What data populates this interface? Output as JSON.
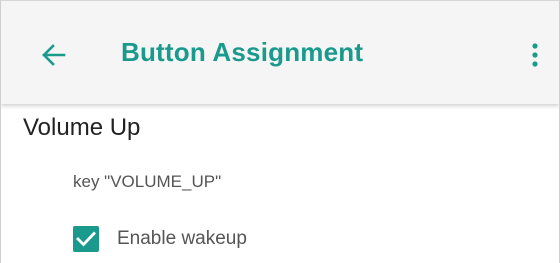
{
  "appbar": {
    "title": "Button Assignment",
    "back_icon": "arrow-back-icon",
    "menu_icon": "more-vert-icon"
  },
  "section": {
    "title": "Volume Up",
    "key_label": "key \"VOLUME_UP\""
  },
  "wakeup": {
    "label": "Enable wakeup",
    "checked": true
  },
  "colors": {
    "accent": "#1a9a8c",
    "appbar_bg": "#f5f5f5"
  }
}
